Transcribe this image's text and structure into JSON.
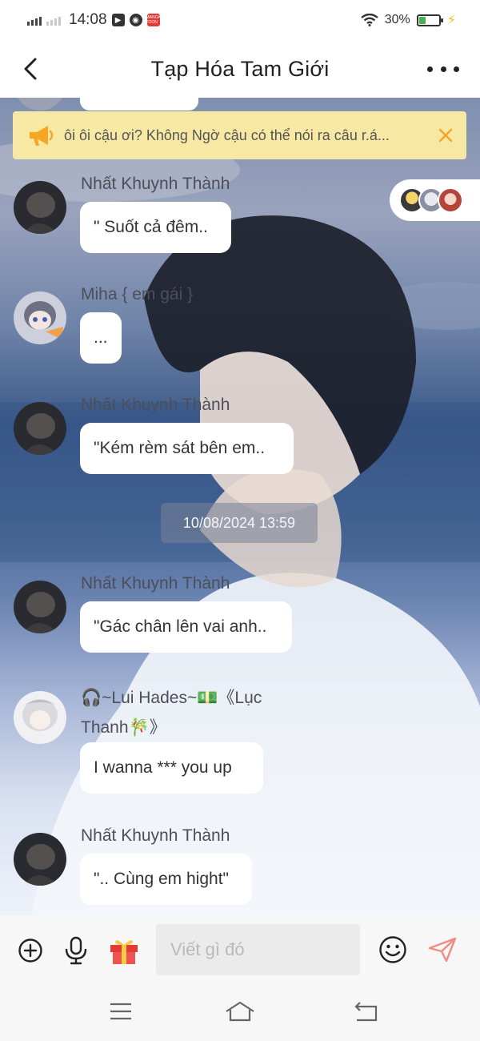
{
  "status_bar": {
    "time": "14:08",
    "manga_label": "MANGA TOON",
    "battery": "30%",
    "battery_level": 0.3
  },
  "header": {
    "title": "Tạp Hóa Tam Giới"
  },
  "announcement": {
    "text": "ôi ôi cậu ơi? Không Ngờ cậu có thể nói ra câu r.á..."
  },
  "messages": [
    {
      "sender": "Nhất Khuynh Thành",
      "text": "\" Suốt cả đêm.."
    },
    {
      "sender": "Miha { em gái }",
      "text": "..."
    },
    {
      "sender": "Nhất Khuynh Thành",
      "text": "\"Kém rèm sát bên em.."
    },
    {
      "sender": "Nhất Khuynh Thành",
      "text": "\"Gác chân lên vai anh.."
    },
    {
      "sender_line1": "🎧~Lui Hades~💵《Lục",
      "sender_line2": "Thanh🎋》",
      "text": "I wanna *** you up"
    },
    {
      "sender": "Nhất Khuynh Thành",
      "text": "\".. Cùng em hight\""
    }
  ],
  "timestamp": "10/08/2024 13:59",
  "input": {
    "placeholder": "Viết gì đó"
  },
  "colors": {
    "announcement_bg": "#f7e9a4",
    "accent_orange": "#f5a623",
    "send_icon": "#f08c84",
    "gift": "#e53935"
  }
}
